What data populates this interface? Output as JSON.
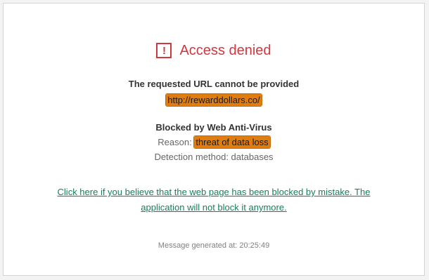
{
  "header": {
    "icon": "exclamation-icon",
    "title": "Access denied"
  },
  "url_section": {
    "heading": "The requested URL cannot be provided",
    "url": "http://rewarddollars.co/"
  },
  "block_section": {
    "heading": "Blocked by Web Anti-Virus",
    "reason_label": "Reason: ",
    "reason_value": "threat of data loss",
    "detection_line": "Detection method: databases"
  },
  "unblock_link": {
    "line1": "Click here if you believe that the web page has been blocked by mistake. The",
    "line2": "application will not block it anymore."
  },
  "footer": {
    "timestamp_label": "Message generated at: ",
    "timestamp_value": "20:25:49"
  },
  "colors": {
    "title": "#d0383f",
    "highlight": "#e07d10",
    "link": "#137f5e"
  }
}
